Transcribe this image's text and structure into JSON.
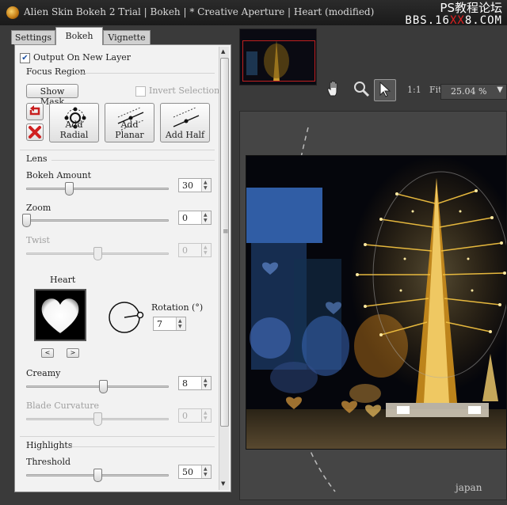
{
  "window": {
    "title": "Alien Skin Bokeh 2 Trial | Bokeh | * Creative Aperture | Heart (modified)",
    "watermark_line1": "PS教程论坛",
    "watermark_line2_a": "BBS.16",
    "watermark_line2_b": "XX",
    "watermark_line2_c": "8.COM"
  },
  "tabs": [
    {
      "label": "Settings",
      "active": false
    },
    {
      "label": "Bokeh",
      "active": true
    },
    {
      "label": "Vignette",
      "active": false
    }
  ],
  "panel": {
    "output_new_layer": {
      "label": "Output On New Layer",
      "checked": true
    },
    "focus_region": {
      "title": "Focus Region",
      "show_mask_label": "Show Mask",
      "invert_selection_label": "Invert Selection",
      "invert_selection_checked": false,
      "add_radial_label": "Add Radial",
      "add_planar_label": "Add Planar",
      "add_half_label": "Add Half"
    },
    "lens": {
      "title": "Lens",
      "bokeh_amount": {
        "label": "Bokeh Amount",
        "value": "30",
        "level": 0.3
      },
      "zoom": {
        "label": "Zoom",
        "value": "0",
        "level": 0.0
      },
      "twist": {
        "label": "Twist",
        "value": "0",
        "level": 0.5
      },
      "shape_label": "Heart",
      "rotation_label": "Rotation (°)",
      "rotation_value": "7",
      "creamy": {
        "label": "Creamy",
        "value": "8",
        "level": 0.54
      },
      "blade_curvature": {
        "label": "Blade Curvature",
        "value": "0",
        "level": 0.5
      }
    },
    "highlights": {
      "title": "Highlights",
      "threshold": {
        "label": "Threshold",
        "value": "50",
        "level": 0.5
      }
    }
  },
  "viewer": {
    "zoom_1to1": "1:1",
    "zoom_fit": "Fit",
    "zoom_value": "25.04 %",
    "caption": "japan"
  },
  "icons": {
    "hand": "hand-tool-icon",
    "magnifier": "zoom-tool-icon",
    "arrow": "select-arrow-icon",
    "reset": "reset-icon",
    "delete": "delete-icon"
  },
  "colors": {
    "accent_red": "#e02020",
    "tree_gold": "#f0c040"
  }
}
